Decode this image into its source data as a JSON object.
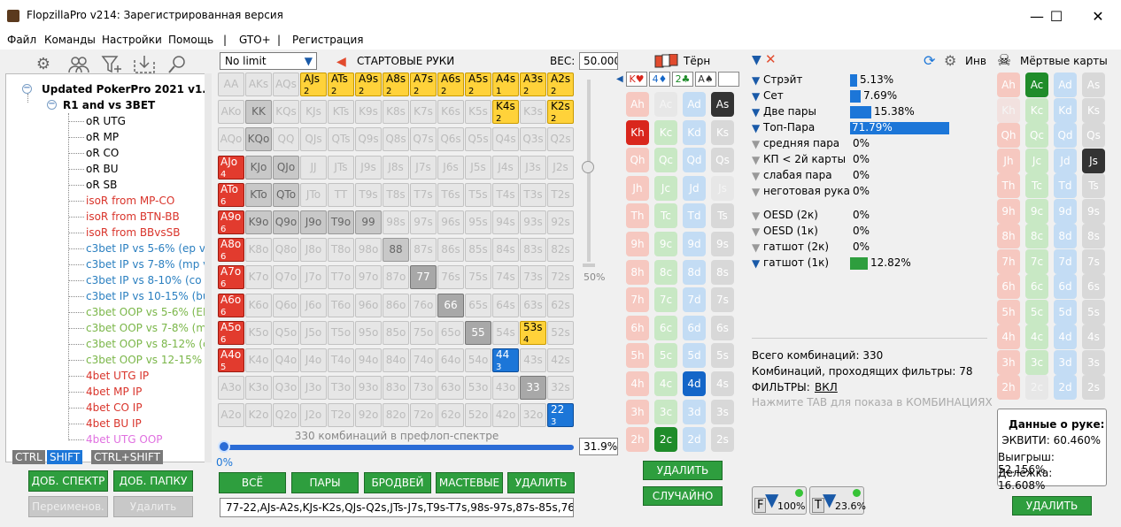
{
  "window": {
    "title": "FlopzillaPro v214: Зарегистрированная версия",
    "minimize": "—",
    "maximize": "☐",
    "close": "✕"
  },
  "menu": [
    "Файл",
    "Команды",
    "Настройки",
    "Помощь",
    "|",
    "GTO+",
    "|",
    "Регистрация"
  ],
  "toolbar_icons": [
    "gear-icon",
    "users-icon",
    "filter-add-icon",
    "import-icon",
    "search-icon"
  ],
  "tree": {
    "root": "Updated PokerPro 2021 v1.2",
    "folder": "R1 and vs 3BET",
    "items": [
      {
        "label": "oR UTG",
        "color": "#000000"
      },
      {
        "label": "oR MP",
        "color": "#000000"
      },
      {
        "label": "oR CO",
        "color": "#000000"
      },
      {
        "label": "oR BU",
        "color": "#000000"
      },
      {
        "label": "oR SB",
        "color": "#000000"
      },
      {
        "label": "isoR from MP-CO",
        "color": "#d9342b"
      },
      {
        "label": "isoR from BTN-BB",
        "color": "#d9342b"
      },
      {
        "label": "isoR from BBvsSB",
        "color": "#d9342b"
      },
      {
        "label": "c3bet IP vs 5-6% (ep vs",
        "color": "#2a7fc0"
      },
      {
        "label": "c3bet IP vs 7-8% (mp vs",
        "color": "#2a7fc0"
      },
      {
        "label": "c3bet IP vs 8-10% (co vs",
        "color": "#2a7fc0"
      },
      {
        "label": "c3bet IP vs 10-15% (bu vs",
        "color": "#2a7fc0"
      },
      {
        "label": "c3bet OOP vs 5-6% (EP c",
        "color": "#7ab648"
      },
      {
        "label": "c3bet OOP vs 7-8% (mp c",
        "color": "#7ab648"
      },
      {
        "label": "c3bet OOP vs 8-12% (co c",
        "color": "#7ab648"
      },
      {
        "label": "c3bet OOP vs 12-15% (bu c",
        "color": "#7ab648"
      },
      {
        "label": "4bet UTG IP",
        "color": "#d9342b"
      },
      {
        "label": "4bet MP IP",
        "color": "#d9342b"
      },
      {
        "label": "4bet CO IP",
        "color": "#d9342b"
      },
      {
        "label": "4bet BU IP",
        "color": "#d9342b"
      },
      {
        "label": "4bet UTG OOP",
        "color": "#e070e0"
      }
    ]
  },
  "modkeys": [
    "CTRL",
    "SHIFT",
    "CTRL+SHIFT"
  ],
  "left_buttons": {
    "add_range": "ДОБ. СПЕКТР",
    "add_folder": "ДОБ. ПАПКУ",
    "rename": "Переименов.",
    "delete": "Удалить"
  },
  "range": {
    "mode": "No limit",
    "title": "СТАРТОВЫЕ РУКИ",
    "weight_label": "ВЕС:",
    "weight_value": "50.000",
    "slider_pct": "50%",
    "combos_label": "330 комбинаций в префлоп-спектре",
    "min_pct": "0%",
    "pct": "31.9%",
    "percent_value": 31.9,
    "buttons": [
      "ВСЁ",
      "ПАРЫ",
      "БРОДВЕЙ",
      "МАСТЕВЫЕ",
      "УДАЛИТЬ"
    ],
    "combo_text": "77-22,AJs-A2s,KJs-K2s,QJs-Q2s,JTs-J7s,T9s-T7s,98s-97s,87s-85s,76"
  },
  "grid": [
    [
      "AA",
      "AKs",
      "AQs",
      "AJs|2",
      "ATs|2",
      "A9s|2",
      "A8s|2",
      "A7s|2",
      "A6s|2",
      "A5s|2",
      "A4s|1",
      "A3s|2",
      "A2s|2"
    ],
    [
      "AKo",
      "KK",
      "KQs",
      "KJs",
      "KTs",
      "K9s",
      "K8s",
      "K7s",
      "K6s",
      "K5s",
      "K4s|2",
      "K3s",
      "K2s|2"
    ],
    [
      "AQo",
      "KQo",
      "QQ",
      "QJs",
      "QTs",
      "Q9s",
      "Q8s",
      "Q7s",
      "Q6s",
      "Q5s",
      "Q4s",
      "Q3s",
      "Q2s"
    ],
    [
      "AJo|4",
      "KJo",
      "QJo",
      "JJ",
      "JTs",
      "J9s",
      "J8s",
      "J7s",
      "J6s",
      "J5s",
      "J4s",
      "J3s",
      "J2s"
    ],
    [
      "ATo|6",
      "KTo",
      "QTo",
      "JTo",
      "TT",
      "T9s",
      "T8s",
      "T7s",
      "T6s",
      "T5s",
      "T4s",
      "T3s",
      "T2s"
    ],
    [
      "A9o|6",
      "K9o",
      "Q9o",
      "J9o",
      "T9o",
      "99",
      "98s",
      "97s",
      "96s",
      "95s",
      "94s",
      "93s",
      "92s"
    ],
    [
      "A8o|6",
      "K8o",
      "Q8o",
      "J8o",
      "T8o",
      "98o",
      "88",
      "87s",
      "86s",
      "85s",
      "84s",
      "83s",
      "82s"
    ],
    [
      "A7o|6",
      "K7o",
      "Q7o",
      "J7o",
      "T7o",
      "97o",
      "87o",
      "77",
      "76s",
      "75s",
      "74s",
      "73s",
      "72s"
    ],
    [
      "A6o|6",
      "K6o",
      "Q6o",
      "J6o",
      "T6o",
      "96o",
      "86o",
      "76o",
      "66",
      "65s",
      "64s",
      "63s",
      "62s"
    ],
    [
      "A5o|6",
      "K5o",
      "Q5o",
      "J5o",
      "T5o",
      "95o",
      "85o",
      "75o",
      "65o",
      "55",
      "54s",
      "53s|4",
      "52s"
    ],
    [
      "A4o|5",
      "K4o",
      "Q4o",
      "J4o",
      "T4o",
      "94o",
      "84o",
      "74o",
      "64o",
      "54o",
      "44|3",
      "43s",
      "42s"
    ],
    [
      "A3o",
      "K3o",
      "Q3o",
      "J3o",
      "T3o",
      "93o",
      "83o",
      "73o",
      "63o",
      "53o",
      "43o",
      "33",
      "32s"
    ],
    [
      "A2o",
      "K2o",
      "Q2o",
      "J2o",
      "T2o",
      "92o",
      "82o",
      "72o",
      "62o",
      "52o",
      "42o",
      "32o",
      "22|3"
    ]
  ],
  "turn": {
    "title": "Тёрн",
    "board": [
      "K♥",
      "4♦",
      "2♣",
      "A♠",
      ""
    ],
    "delete": "УДАЛИТЬ",
    "random": "СЛУЧАЙНО"
  },
  "stats": {
    "inv_label": "Инв",
    "rows": [
      {
        "label": "Стрэйт",
        "value": "5.13%",
        "pct": 5.13
      },
      {
        "label": "Сет",
        "value": "7.69%",
        "pct": 7.69
      },
      {
        "label": "Две пары",
        "value": "15.38%",
        "pct": 15.38
      },
      {
        "label": "Топ-Пара",
        "value": "71.79%",
        "pct": 71.79
      },
      {
        "label": "средняя пара",
        "value": "0%",
        "pct": 0
      },
      {
        "label": "КП < 2й карты",
        "value": "0%",
        "pct": 0
      },
      {
        "label": "слабая пара",
        "value": "0%",
        "pct": 0
      },
      {
        "label": "неготовая рука",
        "value": "0%",
        "pct": 0
      }
    ],
    "draws": [
      {
        "label": "OESD (2к)",
        "value": "0%",
        "pct": 0
      },
      {
        "label": "OESD (1к)",
        "value": "0%",
        "pct": 0
      },
      {
        "label": "гатшот (2к)",
        "value": "0%",
        "pct": 0
      },
      {
        "label": "гатшот (1к)",
        "value": "12.82%",
        "pct": 12.82
      }
    ],
    "total": "Всего комбинаций: 330",
    "passing": "Комбинаций, проходящих фильтры: 78",
    "filters_label": "ФИЛЬТРЫ:",
    "filters_value": "ВКЛ",
    "hint": "Нажмите TAB для показа в КОМБИНАЦИЯХ",
    "f_pct": "100%",
    "t_pct": "23.6%"
  },
  "dead": {
    "title": "Мёртвые карты",
    "delete": "УДАЛИТЬ"
  },
  "hand": {
    "title": "Данные о руке:",
    "equity": "ЭКВИТИ: 60.460%",
    "win": "Выигрыш: 52.156%",
    "tie": "Делёжка: 16.608%"
  },
  "colors": {
    "green_button": "#2e9e3e",
    "selected_blue": "#1c76d8",
    "ranged_yellow": "#ffd23a",
    "ranged_red": "#e23b2e"
  }
}
